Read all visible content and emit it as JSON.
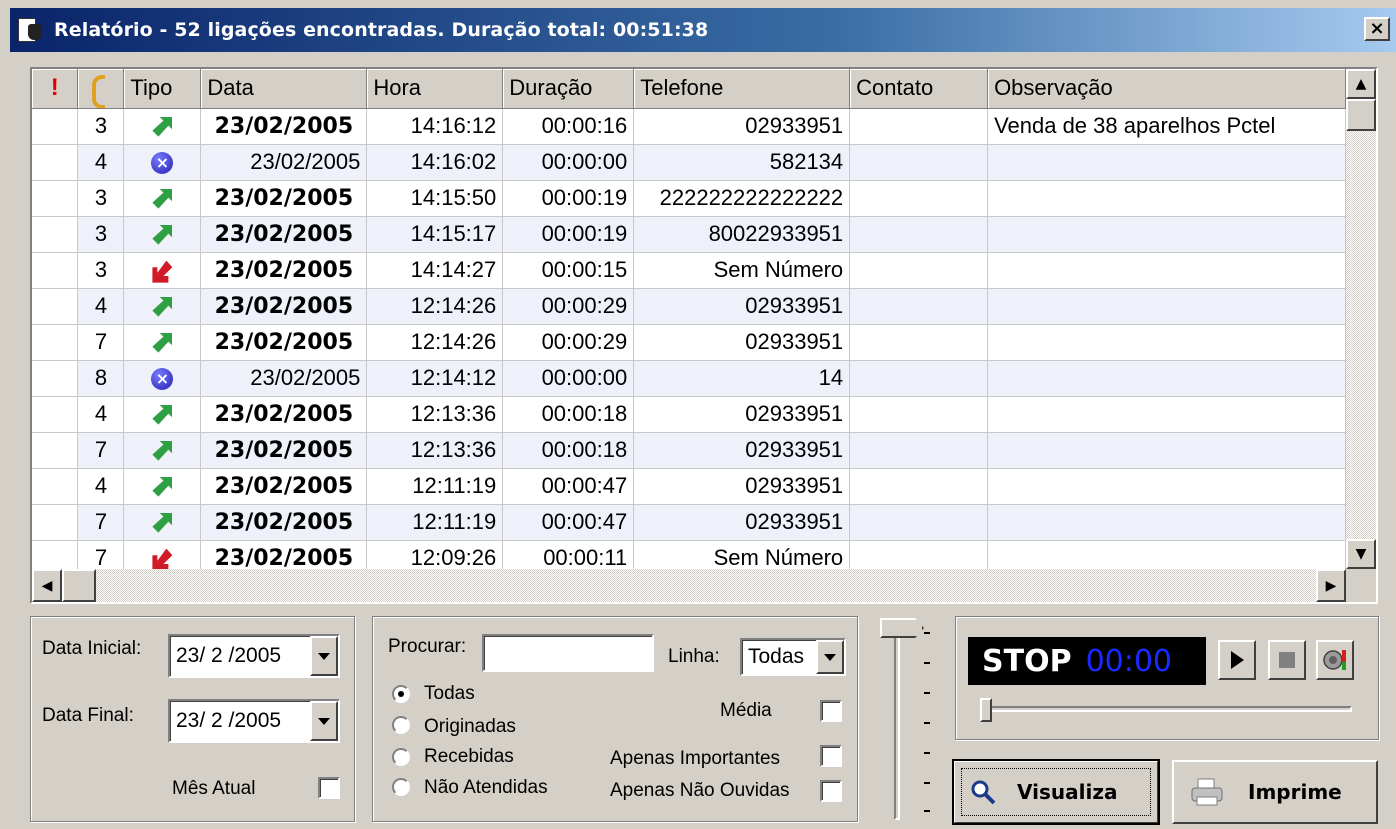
{
  "window": {
    "title": "Relatório - 52 ligações encontradas. Duração total: 00:51:38",
    "close_label": "×"
  },
  "grid": {
    "columns": [
      "!",
      "",
      "Tipo",
      "Data",
      "Hora",
      "Duração",
      "Telefone",
      "Contato",
      "Observação"
    ],
    "rows": [
      {
        "num": "3",
        "tipo": "outgoing-call-icon",
        "data": "23/02/2005",
        "bold": true,
        "hora": "14:16:12",
        "duracao": "00:00:16",
        "telefone": "02933951",
        "contato": "",
        "obs": "Venda de 38 aparelhos Pctel"
      },
      {
        "num": "4",
        "tipo": "missed-call-icon",
        "data": "23/02/2005",
        "bold": false,
        "hora": "14:16:02",
        "duracao": "00:00:00",
        "telefone": "582134",
        "contato": "",
        "obs": ""
      },
      {
        "num": "3",
        "tipo": "outgoing-call-icon",
        "data": "23/02/2005",
        "bold": true,
        "hora": "14:15:50",
        "duracao": "00:00:19",
        "telefone": "222222222222222",
        "contato": "",
        "obs": ""
      },
      {
        "num": "3",
        "tipo": "outgoing-call-icon",
        "data": "23/02/2005",
        "bold": true,
        "hora": "14:15:17",
        "duracao": "00:00:19",
        "telefone": "80022933951",
        "contato": "",
        "obs": ""
      },
      {
        "num": "3",
        "tipo": "incoming-call-icon",
        "data": "23/02/2005",
        "bold": true,
        "hora": "14:14:27",
        "duracao": "00:00:15",
        "telefone": "Sem Número",
        "contato": "",
        "obs": ""
      },
      {
        "num": "4",
        "tipo": "outgoing-call-icon",
        "data": "23/02/2005",
        "bold": true,
        "hora": "12:14:26",
        "duracao": "00:00:29",
        "telefone": "02933951",
        "contato": "",
        "obs": ""
      },
      {
        "num": "7",
        "tipo": "outgoing-call-icon",
        "data": "23/02/2005",
        "bold": true,
        "hora": "12:14:26",
        "duracao": "00:00:29",
        "telefone": "02933951",
        "contato": "",
        "obs": ""
      },
      {
        "num": "8",
        "tipo": "missed-call-icon",
        "data": "23/02/2005",
        "bold": false,
        "hora": "12:14:12",
        "duracao": "00:00:00",
        "telefone": "14",
        "contato": "",
        "obs": ""
      },
      {
        "num": "4",
        "tipo": "outgoing-call-icon",
        "data": "23/02/2005",
        "bold": true,
        "hora": "12:13:36",
        "duracao": "00:00:18",
        "telefone": "02933951",
        "contato": "",
        "obs": ""
      },
      {
        "num": "7",
        "tipo": "outgoing-call-icon",
        "data": "23/02/2005",
        "bold": true,
        "hora": "12:13:36",
        "duracao": "00:00:18",
        "telefone": "02933951",
        "contato": "",
        "obs": ""
      },
      {
        "num": "4",
        "tipo": "outgoing-call-icon",
        "data": "23/02/2005",
        "bold": true,
        "hora": "12:11:19",
        "duracao": "00:00:47",
        "telefone": "02933951",
        "contato": "",
        "obs": ""
      },
      {
        "num": "7",
        "tipo": "outgoing-call-icon",
        "data": "23/02/2005",
        "bold": true,
        "hora": "12:11:19",
        "duracao": "00:00:47",
        "telefone": "02933951",
        "contato": "",
        "obs": ""
      },
      {
        "num": "7",
        "tipo": "incoming-call-icon",
        "data": "23/02/2005",
        "bold": true,
        "hora": "12:09:26",
        "duracao": "00:00:11",
        "telefone": "Sem Número",
        "contato": "",
        "obs": ""
      }
    ]
  },
  "dates": {
    "inicial_label": "Data Inicial:",
    "inicial_value": "23/ 2 /2005",
    "final_label": "Data Final:",
    "final_value": "23/ 2 /2005",
    "mes_atual_label": "Mês Atual",
    "mes_atual_checked": false
  },
  "filters": {
    "procurar_label": "Procurar:",
    "procurar_value": "",
    "linha_label": "Linha:",
    "linha_value": "Todas",
    "radios": [
      {
        "label": "Todas",
        "selected": true
      },
      {
        "label": "Originadas",
        "selected": false
      },
      {
        "label": "Recebidas",
        "selected": false
      },
      {
        "label": "Não Atendidas",
        "selected": false
      }
    ],
    "media_label": "Média",
    "importantes_label": "Apenas Importantes",
    "nao_ouvidas_label": "Apenas Não Ouvidas"
  },
  "player": {
    "state": "STOP",
    "time": "00:00",
    "position_fraction": 0
  },
  "buttons": {
    "visualiza": "Visualiza",
    "imprime": "Imprime"
  }
}
